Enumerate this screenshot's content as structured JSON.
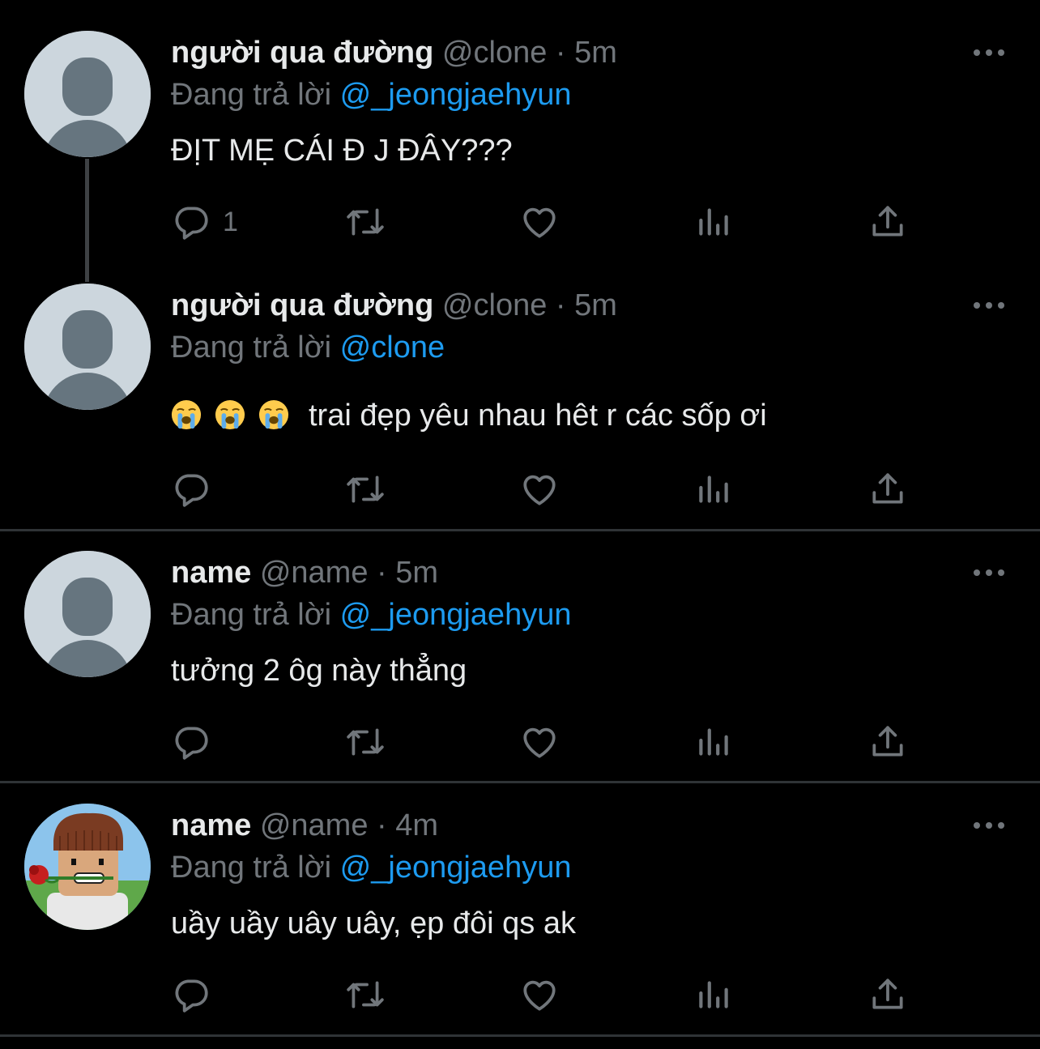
{
  "tweets": [
    {
      "display_name": "người qua đường",
      "handle": "@clone",
      "separator": "·",
      "time": "5m",
      "reply_prefix": "Đang trả lời",
      "reply_to": "@_jeongjaehyun",
      "text": "ĐỊT MẸ CÁI Đ J ĐÂY???",
      "reply_count": "1",
      "avatar": "default-avatar"
    },
    {
      "display_name": "người qua đường",
      "handle": "@clone",
      "separator": "·",
      "time": "5m",
      "reply_prefix": "Đang trả lời",
      "reply_to": "@clone",
      "emojis": [
        "loudly-crying-face",
        "loudly-crying-face",
        "loudly-crying-face"
      ],
      "text": "trai đẹp yêu nhau hêt r các sốp ơi",
      "reply_count": "",
      "avatar": "default-avatar"
    },
    {
      "display_name": "name",
      "handle": "@name",
      "separator": "·",
      "time": "5m",
      "reply_prefix": "Đang trả lời",
      "reply_to": "@_jeongjaehyun",
      "text": "tưởng 2 ôg này thẳng",
      "reply_count": "",
      "avatar": "default-avatar"
    },
    {
      "display_name": "name",
      "handle": "@name",
      "separator": "·",
      "time": "4m",
      "reply_prefix": "Đang trả lời",
      "reply_to": "@_jeongjaehyun",
      "text": "uầy uầy uây uây, ẹp đôi qs ak",
      "reply_count": "",
      "avatar": "character-with-rose-avatar"
    }
  ],
  "icons": {
    "reply": "reply-icon",
    "retweet": "retweet-icon",
    "like": "heart-icon",
    "views": "views-icon",
    "share": "share-icon",
    "more": "more-icon"
  },
  "colors": {
    "background": "#000000",
    "primary_text": "#e7e9ea",
    "secondary_text": "#71767b",
    "mention": "#1d9bf0",
    "divider": "#2f3336"
  }
}
